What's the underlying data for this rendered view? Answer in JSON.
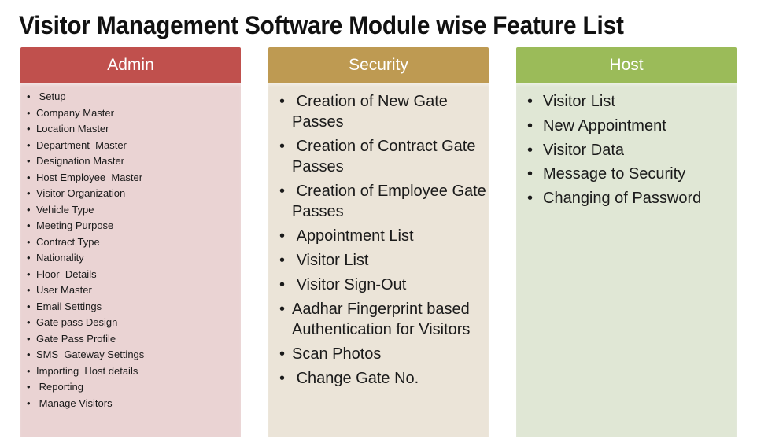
{
  "title": "Visitor Management Software Module wise Feature List",
  "colors": {
    "admin_header": "#C0504D",
    "admin_body": "#EAD3D3",
    "security_header": "#BE9A52",
    "security_body": "#EBE4D8",
    "host_header": "#9BBB59",
    "host_body": "#E0E7D5"
  },
  "bullet": "•",
  "modules": {
    "admin": {
      "header": "Admin",
      "items": [
        " Setup",
        "Company Master",
        "Location Master",
        "Department  Master",
        "Designation Master",
        "Host Employee  Master",
        "Visitor Organization",
        "Vehicle Type",
        "Meeting Purpose",
        "Contract Type",
        "Nationality",
        "Floor  Details",
        "User Master",
        "Email Settings",
        "Gate pass Design",
        "Gate Pass Profile",
        "SMS  Gateway Settings",
        "Importing  Host details",
        " Reporting",
        " Manage Visitors"
      ]
    },
    "security": {
      "header": "Security",
      "items": [
        " Creation of New Gate Passes",
        " Creation of Contract Gate Passes",
        " Creation of Employee Gate Passes",
        " Appointment List",
        " Visitor List",
        " Visitor Sign-Out",
        "Aadhar Fingerprint based Authentication for Visitors",
        "Scan Photos",
        " Change Gate No."
      ]
    },
    "host": {
      "header": "Host",
      "items": [
        "Visitor List",
        "New Appointment",
        "Visitor Data",
        "Message to Security",
        "Changing of Password"
      ]
    }
  }
}
